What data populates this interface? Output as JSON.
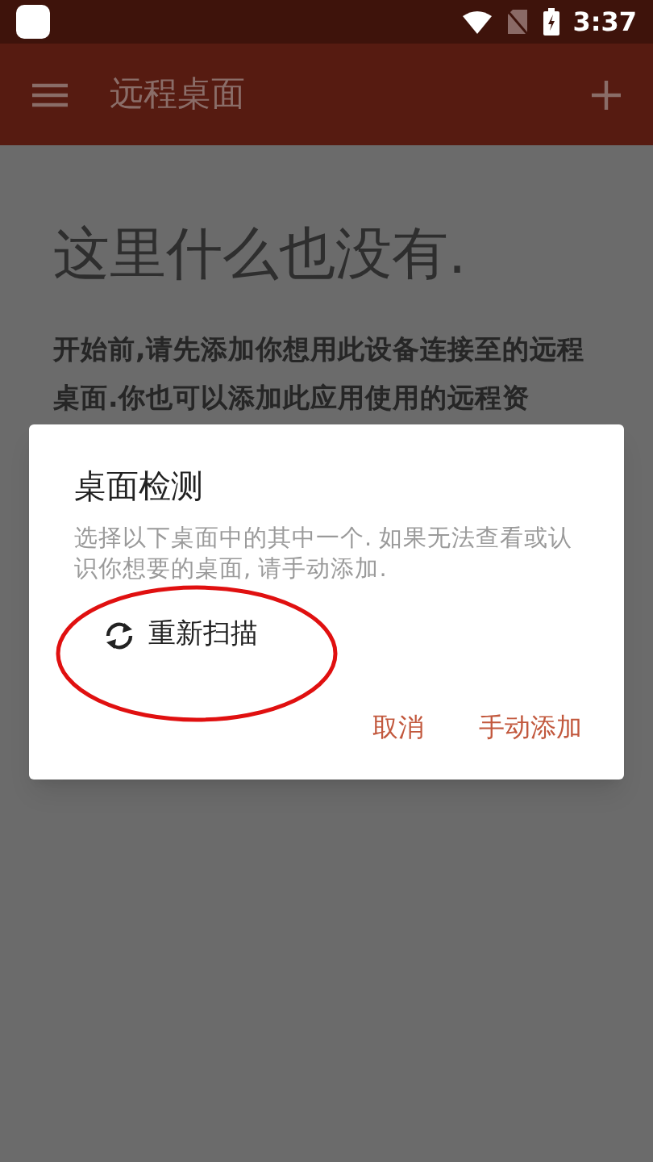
{
  "status_bar": {
    "time": "3:37"
  },
  "app_bar": {
    "title": "远程桌面"
  },
  "empty_state": {
    "heading": "这里什么也没有.",
    "body": "开始前,请先添加你想用此设备连接至的远程桌面.你也可以添加此应用使用的远程资"
  },
  "dialog": {
    "title": "桌面检测",
    "message": "选择以下桌面中的其中一个. 如果无法查看或认识你想要的桌面, 请手动添加.",
    "rescan_label": "重新扫描",
    "buttons": [
      "取消",
      "手动添加"
    ]
  }
}
